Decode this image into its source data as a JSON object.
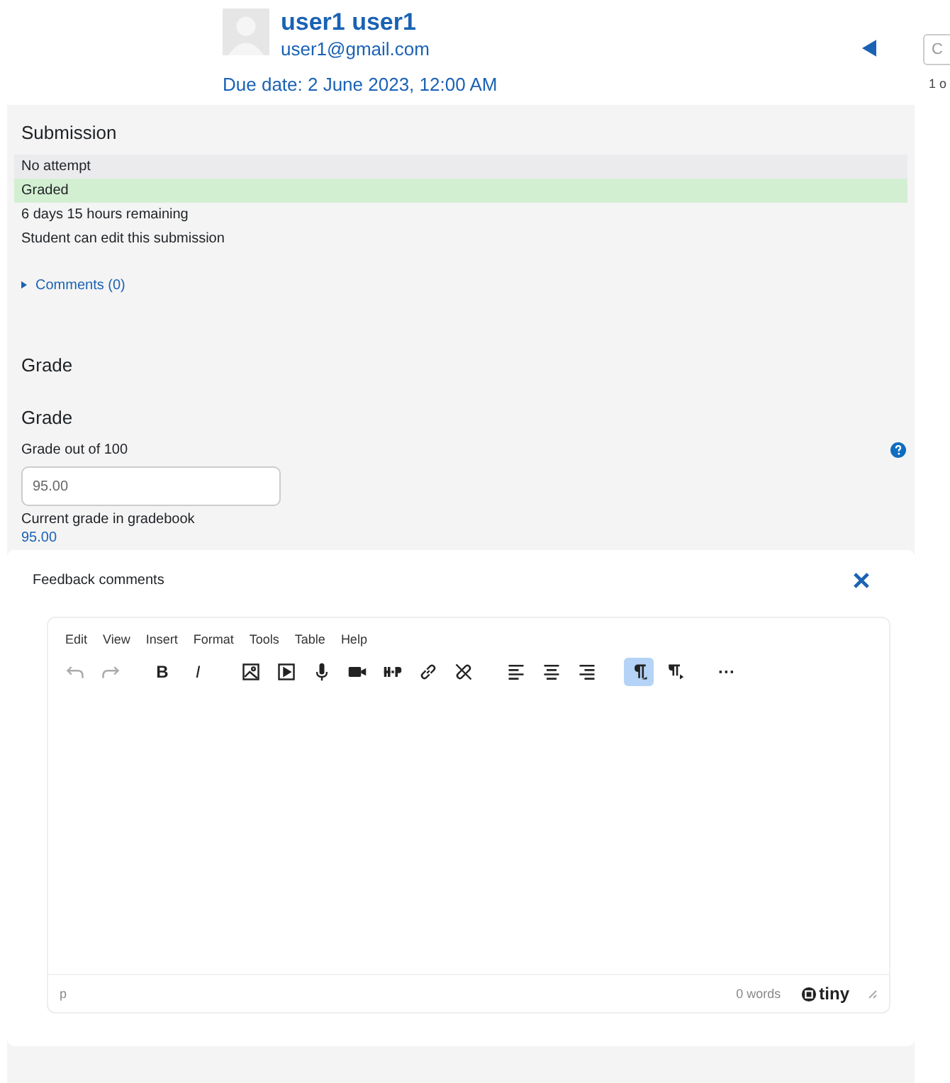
{
  "user": {
    "name": "user1 user1",
    "email": "user1@gmail.com",
    "due": "Due date: 2 June 2023, 12:00 AM"
  },
  "nav": {
    "field_value": "C",
    "counter": "1 o"
  },
  "submission": {
    "title": "Submission",
    "rows": [
      {
        "text": "No attempt",
        "color": "#ebebee"
      },
      {
        "text": "Graded",
        "color": "#d3efd2"
      },
      {
        "text": "6 days 15 hours remaining"
      },
      {
        "text": "Student can edit this submission"
      }
    ],
    "comments": {
      "label": "Comments (0)",
      "expanded": false
    }
  },
  "grade": {
    "section_title": "Grade",
    "title": "Grade",
    "label": "Grade out of 100",
    "value": "95.00",
    "current_label": "Current grade in gradebook",
    "current_value": "95.00"
  },
  "feedback": {
    "title": "Feedback comments",
    "menu": [
      "Edit",
      "View",
      "Insert",
      "Format",
      "Tools",
      "Table",
      "Help"
    ],
    "toolbar": [
      {
        "kind": "undo",
        "selected": false,
        "disabled": true
      },
      {
        "kind": "redo",
        "selected": false,
        "disabled": true
      },
      {
        "kind": "gap"
      },
      {
        "kind": "bold",
        "label": "B",
        "selected": false,
        "disabled": false
      },
      {
        "kind": "italic",
        "label": "I",
        "selected": false,
        "disabled": false
      },
      {
        "kind": "gap"
      },
      {
        "kind": "image",
        "selected": false,
        "disabled": false
      },
      {
        "kind": "media",
        "selected": false,
        "disabled": false
      },
      {
        "kind": "mic",
        "selected": false,
        "disabled": false
      },
      {
        "kind": "camera",
        "selected": false,
        "disabled": false
      },
      {
        "kind": "h5p",
        "selected": false,
        "disabled": false
      },
      {
        "kind": "link",
        "selected": false,
        "disabled": false
      },
      {
        "kind": "unlink",
        "selected": false,
        "disabled": false
      },
      {
        "kind": "gap"
      },
      {
        "kind": "align-left",
        "selected": false,
        "disabled": false
      },
      {
        "kind": "align-center",
        "selected": false,
        "disabled": false
      },
      {
        "kind": "align-right",
        "selected": false,
        "disabled": false
      },
      {
        "kind": "gap"
      },
      {
        "kind": "ltr",
        "selected": true,
        "disabled": false
      },
      {
        "kind": "rtl",
        "selected": false,
        "disabled": false
      },
      {
        "kind": "gap"
      },
      {
        "kind": "more",
        "label": "···",
        "selected": false,
        "disabled": false
      }
    ],
    "path": "p",
    "words": "0 words",
    "brand": "tiny"
  }
}
